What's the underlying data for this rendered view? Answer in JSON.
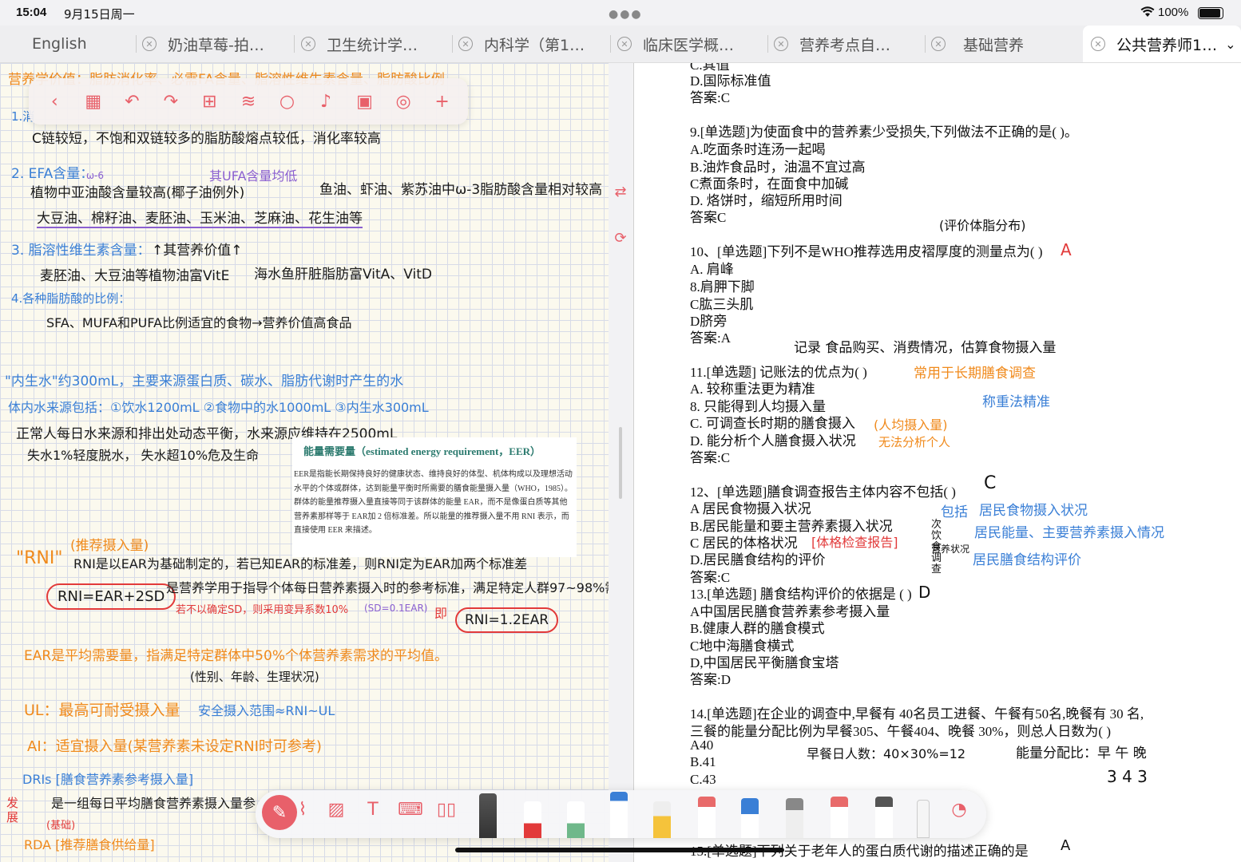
{
  "status": {
    "time": "15:04",
    "date": "9月15日周一",
    "battery": "100%",
    "battery_level": 1.0
  },
  "tabs": [
    {
      "label": "English"
    },
    {
      "label": "奶油草莓-拍…"
    },
    {
      "label": "卫生统计学…"
    },
    {
      "label": "内科学（第1…"
    },
    {
      "label": "临床医学概…"
    },
    {
      "label": "营养考点自…"
    },
    {
      "label": "基础营养"
    },
    {
      "label": "公共营养师1…"
    }
  ],
  "notes_toolbar": {
    "icons": [
      "back-icon",
      "grid-icon",
      "undo-icon",
      "redo-icon",
      "add-page-icon",
      "layers-icon",
      "search-icon",
      "mic-icon",
      "sticker-icon",
      "globe-icon",
      "add-icon"
    ]
  },
  "left": {
    "l1": "营养学价值：脂肪消化率、必需FA含量、脂溶性维生素含量、脂肪酸比例",
    "l2a": "1.消",
    "l3": "C链较短，不饱和双链较多的脂肪酸熔点较低，消化率较高",
    "l4": "2. EFA含量：",
    "l4b": "ω-6",
    "l4c": "其UFA含量均低",
    "l5": "植物中亚油酸含量较高(椰子油例外)",
    "l5b": "鱼油、虾油、紫苏油中ω-3脂肪酸含量相对较高",
    "l6": "大豆油、棉籽油、麦胚油、玉米油、芝麻油、花生油等",
    "l7": "3. 脂溶性维生素含量：",
    "l7b": "↑其营养价值↑",
    "l8": "麦胚油、大豆油等植物油富VitE",
    "l8b": "海水鱼肝脏脂肪富VitA、VitD",
    "l9": "4.各种脂肪酸的比例：",
    "l10": "SFA、MUFA和PUFA比例适宜的食物→营养价值高食品",
    "l11": "\"内生水\"约300mL，主要来源蛋白质、碳水、脂肪代谢时产生的水",
    "l12": "体内水来源包括：①饮水1200mL  ②食物中的水1000mL  ③内生水300mL",
    "l13": "正常人每日水来源和排出处动态平衡，水来源应维持在2500mL",
    "l14": "失水1%轻度脱水，  失水超10%危及生命",
    "l15": "\"RNI\"",
    "l15b": "(推荐摄入量)",
    "l16": "RNI是以EAR为基础制定的，若已知EAR的标准差，则RNI定为EAR加两个标准差",
    "l17": "RNI=EAR+2SD",
    "l17b": "是营养学用于指导个体每日营养素摄入时的参考标准，满足特定人群97~98%需求",
    "l18": "若不以确定SD，则采用变异系数10%",
    "l18b": "(SD=0.1EAR)",
    "l18c": "即",
    "l18d": "RNI=1.2EAR",
    "l19": "EAR是平均需要量，指满足特定群体中50%个体营养素需求的平均值。",
    "l20": "(性别、年龄、生理状况)",
    "l21": "UL：最高可耐受摄入量",
    "l21b": "安全摄入范围≈RNI~UL",
    "l22": "AI：适宜摄入量(某营养素未设定RNI时可参考)",
    "l23": "DRIs [膳食营养素参考摄入量]",
    "l24a": "发展",
    "l24": "是一组每日平均膳食营养素摄入量参",
    "l24b": "(基础)",
    "l25": "RDA [推荐膳食供给量]"
  },
  "pasted": {
    "title": "能量需要量（estimated energy requirement，EER）",
    "p1": "EER是指能长期保持良好的健康状态、维持良好的体型、机体构成以及理想活动水平的个体或群体，达到能量平衡时所需要的膳食能量摄入量（WHO，1985）。",
    "p2": "群体的能量推荐摄入量直接等同于该群体的能量 EAR，而不是像蛋白质等其他营养素那样等于 EAR加 2 倍标准差。所以能量的推荐摄入量不用 RNI 表示，而直接使用 EER 来描述。"
  },
  "right": {
    "lines": [
      "D.国际标准值",
      "答案:C",
      "9.[单选题]为使面食中的营养素少受损失,下列做法不正确的是( )。",
      "A.吃面条时连汤一起喝",
      "B.油炸食品时，油温不宜过高",
      "C煮面条时，在面食中加碱",
      "D. 烙饼时，缩短所用时间",
      "答案C",
      "10、[单选题]下列不是WHO推荐选用皮褶厚度的测量点为( )",
      "A. 肩峰",
      "8.肩胛下脚",
      "C肱三头肌",
      "D脐旁",
      "答案:A",
      "11.[单选题] 记账法的优点为( )",
      "A. 较称重法更为精准",
      "8. 只能得到人均摄入量",
      "C. 可调查长时期的膳食摄入",
      "D. 能分析个人膳食摄入状况",
      "答案:C",
      "12、[单选题]膳食调查报告主体内容不包括( )",
      "A 居民食物摄入状况",
      "B.居民能量和要主营养素摄入状况",
      "C 居民的体格状况",
      "D.居民膳食结构的评价",
      "答案:C",
      "13.[单选题] 膳食结构评价的依据是 ( )",
      "A中国居民膳食营养素参考摄入量",
      "B.健康人群的膳食模式",
      "C地中海膳食横式",
      "D,中国居民平衡膳食宝塔",
      "答案:D",
      "14.[单选题]在企业的调查中,早餐有 40名员工进餐、午餐有50名,晚餐有 30 名,",
      "三餐的能量分配比例为早餐305、午餐404、晚餐 30%，则总人日数为( )",
      "A40",
      "B.41",
      "C.43",
      "15.[单选题]下列关于老年人的蛋白质代谢的描述正确的是"
    ],
    "top_cut": "C.其值",
    "notes": {
      "n1": "(评价体脂分布)",
      "n1b": "A",
      "n2": "记录  食品购买、消费情况，估算食物摄入量",
      "n3": "常用于长期膳食调查",
      "n4": "称重法精准",
      "n5": "(人均摄入量)",
      "n5b": "无法分析个人",
      "n6": "C",
      "n7": "包括",
      "n7a": "居民食物摄入状况",
      "n7b": "居民能量、主要营养素摄入情况",
      "n7c": "居民膳食结构评价",
      "n8": "[体格检查报告]",
      "n9": "D",
      "n10": "早餐日人数：40×30%=12",
      "n11": "能量分配比：早 午 晚",
      "n12": "3  4  3",
      "n13": "A",
      "n14": "次饮食调查",
      "n15": "营养状况"
    }
  },
  "pen_toolbar": {
    "tools": [
      "lasso-icon",
      "image-icon",
      "textbox-icon",
      "keyboard-icon",
      "book-icon"
    ],
    "pens": [
      "fountain-pen",
      "red-pen",
      "green-pencil",
      "blue-pen",
      "yellow-highlighter",
      "pink-eraser",
      "blue-marker",
      "gray-pencil",
      "red-marker",
      "black-marker",
      "ruler"
    ]
  },
  "colors": {
    "accent": "#e8606a",
    "grid": "#d7dbe8",
    "paper": "#fbf9ee"
  }
}
